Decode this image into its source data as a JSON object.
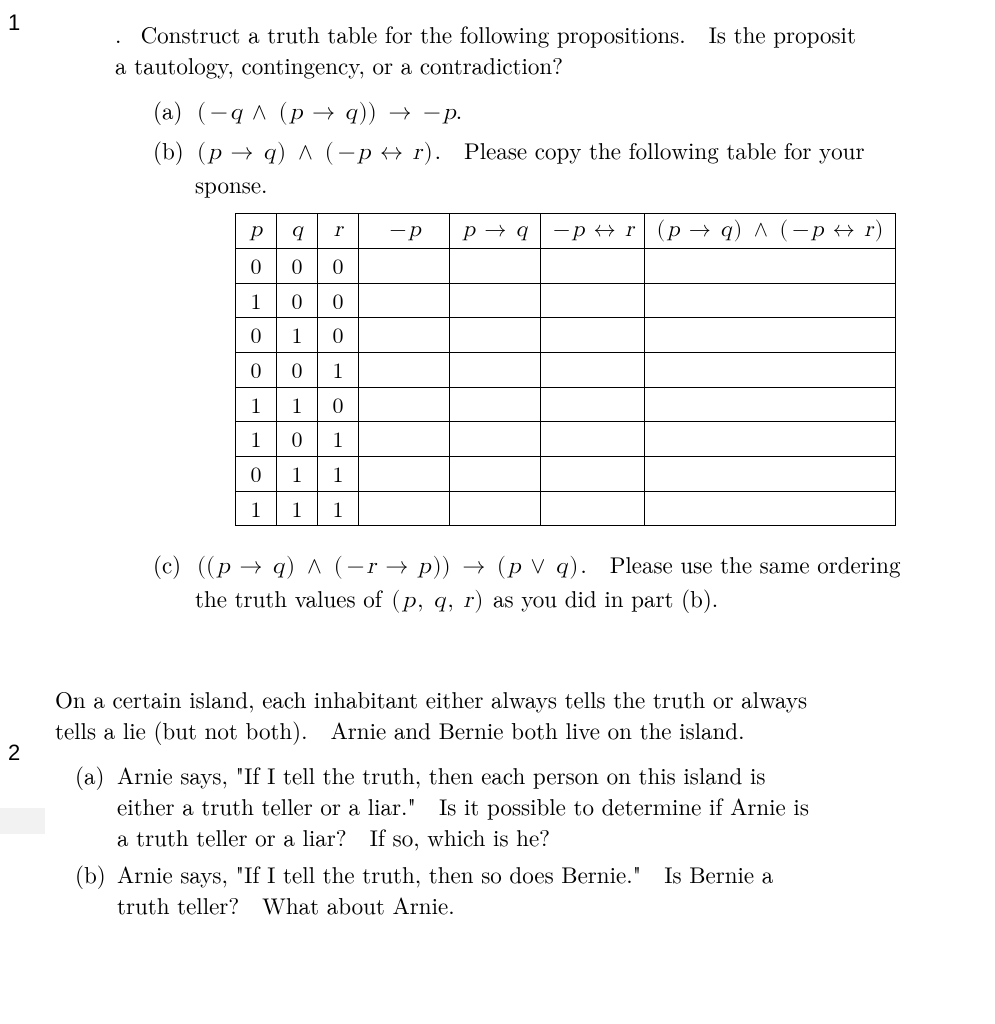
{
  "problem1": {
    "number": "1",
    "leading_dot": ".",
    "intro": "Construct a truth table for the following propositions. Is the proposit",
    "intro2": "a tautology, contingency, or a contradiction?",
    "a": {
      "label": "(a)",
      "expr_plain": "(¬q ∧ (p → q)) → ¬p",
      "period": "."
    },
    "b": {
      "label": "(b)",
      "expr_plain": "(p → q) ∧ (¬p ↔ r)",
      "after": ". Please copy the following table for your",
      "after2": "sponse."
    },
    "table": {
      "headers": [
        "p",
        "q",
        "r",
        "¬p",
        "p → q",
        "¬p ↔ r",
        "(p → q) ∧ (¬p ↔ r)"
      ],
      "rows": [
        [
          "0",
          "0",
          "0",
          "",
          "",
          "",
          ""
        ],
        [
          "1",
          "0",
          "0",
          "",
          "",
          "",
          ""
        ],
        [
          "0",
          "1",
          "0",
          "",
          "",
          "",
          ""
        ],
        [
          "0",
          "0",
          "1",
          "",
          "",
          "",
          ""
        ],
        [
          "1",
          "1",
          "0",
          "",
          "",
          "",
          ""
        ],
        [
          "1",
          "0",
          "1",
          "",
          "",
          "",
          ""
        ],
        [
          "0",
          "1",
          "1",
          "",
          "",
          "",
          ""
        ],
        [
          "1",
          "1",
          "1",
          "",
          "",
          "",
          ""
        ]
      ]
    },
    "c": {
      "label": "(c)",
      "expr_plain": "((p → q) ∧ (¬r → p)) → (p ∨ q)",
      "after": ". Please use the same ordering",
      "line2_pre": "the truth values of ",
      "line2_expr": "(p, q, r)",
      "line2_post": " as you did in part (b)."
    }
  },
  "problem2": {
    "number": "2",
    "intro_l1": "On a certain island, each inhabitant either always tells the truth or always",
    "intro_l2": "tells a lie (but not both). Arnie and Bernie both live on the island.",
    "a": {
      "label": "(a)",
      "l1": "Arnie says, \"If I tell the truth, then each person on this island is",
      "l2": "either a truth teller or a liar.\" Is it possible to determine if Arnie is",
      "l3": "a truth teller or a liar? If so, which is he?"
    },
    "b": {
      "label": "(b)",
      "l1": "Arnie says, \"If I tell the truth, then so does Bernie.\" Is Bernie a",
      "l2": "truth teller? What about Arnie."
    }
  }
}
